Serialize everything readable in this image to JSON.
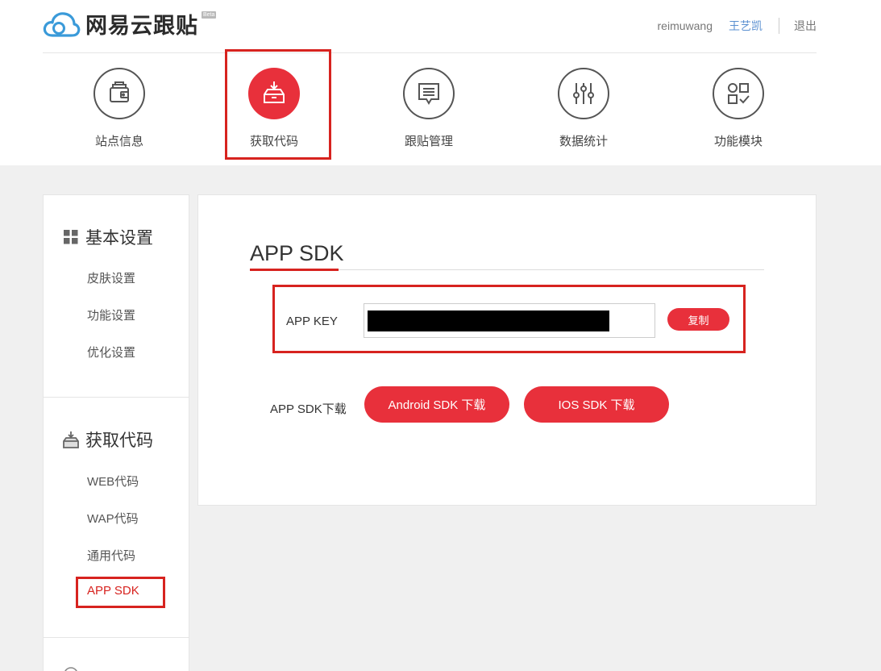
{
  "brand": {
    "name": "网易云跟贴",
    "badge": "Beta"
  },
  "user": {
    "username": "reimuwang",
    "display_name": "王艺凯",
    "logout": "退出"
  },
  "top_nav": [
    {
      "label": "站点信息",
      "icon": "wallet-icon"
    },
    {
      "label": "获取代码",
      "icon": "download-box-icon",
      "active": true
    },
    {
      "label": "跟贴管理",
      "icon": "comment-icon"
    },
    {
      "label": "数据统计",
      "icon": "sliders-icon"
    },
    {
      "label": "功能模块",
      "icon": "modules-icon"
    }
  ],
  "sidebar": {
    "sections": [
      {
        "title": "基本设置",
        "icon": "grid-icon",
        "items": [
          "皮肤设置",
          "功能设置",
          "优化设置"
        ]
      },
      {
        "title": "获取代码",
        "icon": "inbox-icon",
        "items": [
          "WEB代码",
          "WAP代码",
          "通用代码",
          "APP SDK"
        ]
      }
    ],
    "active_item": "APP SDK"
  },
  "main": {
    "title": "APP SDK",
    "app_key": {
      "label": "APP KEY",
      "value_redacted": true,
      "copy_label": "复制"
    },
    "sdk_download": {
      "label": "APP SDK下载",
      "android_label": "Android SDK 下载",
      "ios_label": "IOS SDK 下载"
    }
  },
  "colors": {
    "accent": "#e8303b",
    "highlight_border": "#d7231f",
    "link": "#5a8fd0",
    "background": "#f0f0f0"
  }
}
